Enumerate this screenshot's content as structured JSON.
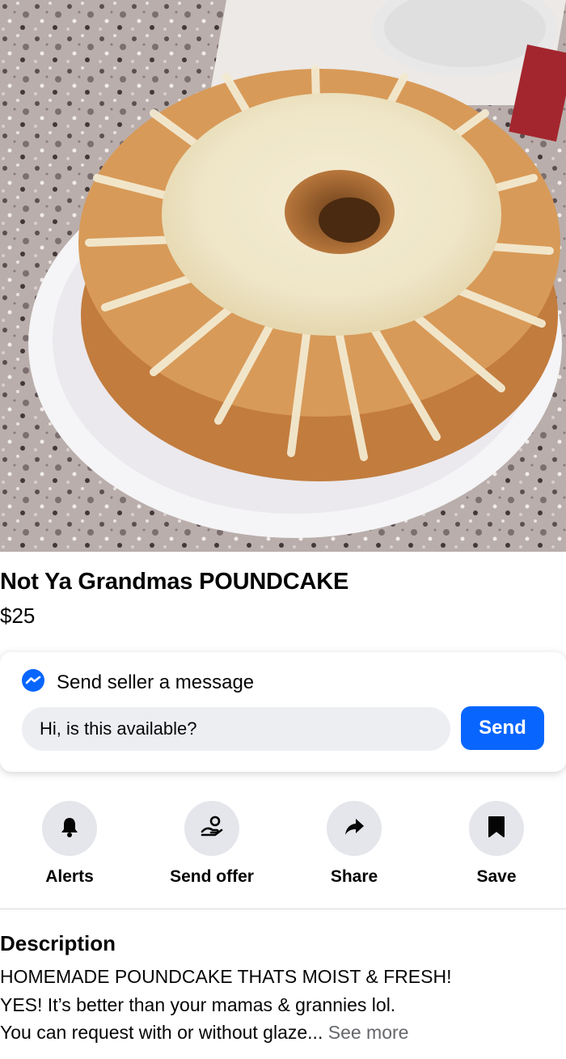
{
  "listing": {
    "title": "Not Ya Grandmas POUNDCAKE",
    "price": "$25"
  },
  "message": {
    "header": "Send seller a message",
    "input_value": "Hi, is this available?",
    "send_label": "Send",
    "icon": "messenger-icon"
  },
  "actions": [
    {
      "label": "Alerts",
      "icon": "bell-icon"
    },
    {
      "label": "Send offer",
      "icon": "offer-icon"
    },
    {
      "label": "Share",
      "icon": "share-arrow-icon"
    },
    {
      "label": "Save",
      "icon": "bookmark-icon"
    }
  ],
  "description": {
    "heading": "Description",
    "lines": [
      "HOMEMADE POUNDCAKE THATS MOIST & FRESH!",
      "YES! It’s better than your mamas & grannies lol.",
      "You can request with or without glaze..."
    ],
    "see_more": "See more"
  },
  "colors": {
    "accent": "#0866ff",
    "action_circle": "#e4e6eb",
    "muted_text": "#65676b"
  }
}
